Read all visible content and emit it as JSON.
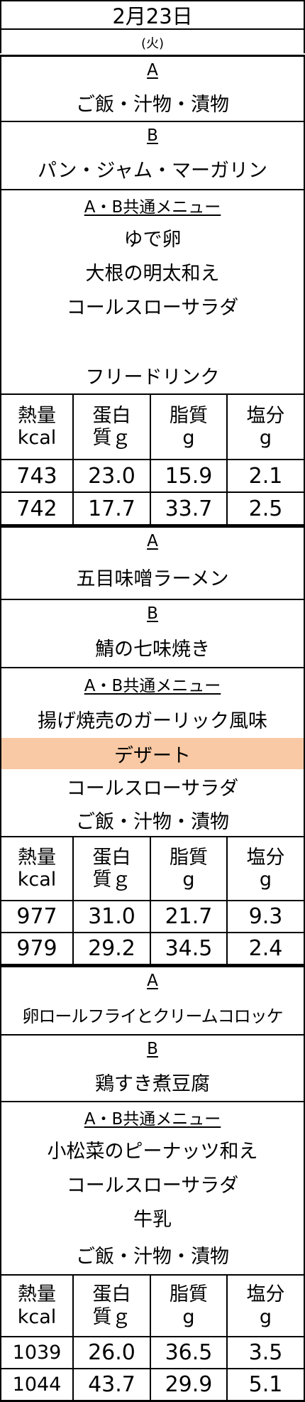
{
  "header": {
    "date": "2月23日",
    "weekday": "(火)"
  },
  "meals": [
    {
      "label_a": "A",
      "menu_a": "ご飯・汁物・漬物",
      "label_b": "B",
      "menu_b": "パン・ジャム・マーガリン",
      "common_label": "A・B共通メニュー",
      "common_items": [
        "ゆで卵",
        "大根の明太和え",
        "コールスローサラダ",
        "",
        "フリードリンク"
      ],
      "nutrition": {
        "headers": [
          [
            "熱量",
            "kcal"
          ],
          [
            "蛋白",
            "質ｇ"
          ],
          [
            "脂質",
            "g"
          ],
          [
            "塩分",
            "g"
          ]
        ],
        "rows": [
          [
            "743",
            "23.0",
            "15.9",
            "2.1"
          ],
          [
            "742",
            "17.7",
            "33.7",
            "2.5"
          ]
        ]
      }
    },
    {
      "label_a": "A",
      "menu_a": "五目味噌ラーメン",
      "label_b": "B",
      "menu_b": "鯖の七味焼き",
      "common_label": "A・B共通メニュー",
      "common_items": [
        "揚げ焼売のガーリック風味",
        "デザート",
        "コールスローサラダ",
        "ご飯・汁物・漬物"
      ],
      "nutrition": {
        "headers": [
          [
            "熱量",
            "kcal"
          ],
          [
            "蛋白",
            "質ｇ"
          ],
          [
            "脂質",
            "g"
          ],
          [
            "塩分",
            "g"
          ]
        ],
        "rows": [
          [
            "977",
            "31.0",
            "21.7",
            "9.3"
          ],
          [
            "979",
            "29.2",
            "34.5",
            "2.4"
          ]
        ]
      }
    },
    {
      "label_a": "A",
      "menu_a": "卵ロールフライとクリームコロッケ",
      "label_b": "B",
      "menu_b": "鶏すき煮豆腐",
      "common_label": "A・B共通メニュー",
      "common_items": [
        "小松菜のピーナッツ和え",
        "コールスローサラダ",
        "牛乳",
        "ご飯・汁物・漬物"
      ],
      "nutrition": {
        "headers": [
          [
            "熱量",
            "kcal"
          ],
          [
            "蛋白",
            "質ｇ"
          ],
          [
            "脂質",
            "g"
          ],
          [
            "塩分",
            "g"
          ]
        ],
        "rows": [
          [
            "1039",
            "26.0",
            "36.5",
            "3.5"
          ],
          [
            "1044",
            "43.7",
            "29.9",
            "5.1"
          ]
        ]
      }
    }
  ],
  "colors": {
    "highlight": "#f8c9a4",
    "border": "#000000"
  }
}
